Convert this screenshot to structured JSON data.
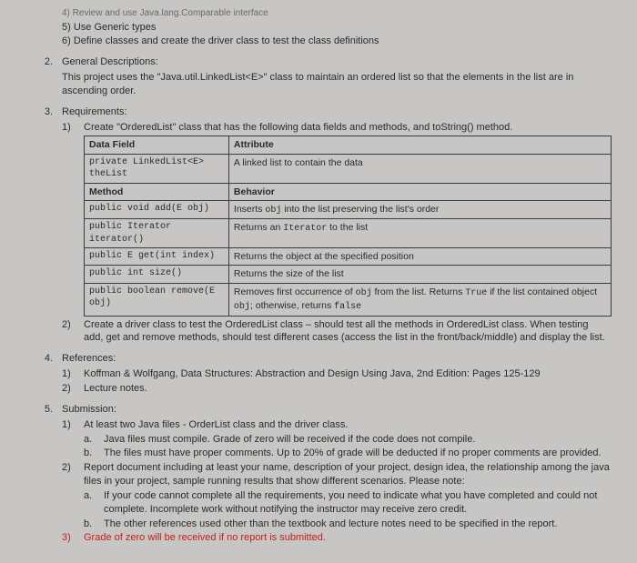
{
  "top": {
    "line4": "4) Review and use Java.lang.Comparable interface",
    "line5": "5) Use Generic types",
    "line6": "6) Define classes and create the driver class to test the class definitions"
  },
  "s2": {
    "num": "2.",
    "title": "General Descriptions:",
    "body": "This project uses the \"Java.util.LinkedList<E>\" class to maintain an ordered list so that the elements in the list are in ascending order."
  },
  "s3": {
    "num": "3.",
    "title": "Requirements:",
    "r1num": "1)",
    "r1": "Create \"OrderedList\" class that has the following data fields and methods, and toString() method.",
    "table": {
      "h1": "Data Field",
      "h2": "Attribute",
      "r1a": "private LinkedList<E> theList",
      "r1b": "A linked list to contain the data",
      "h3": "Method",
      "h4": "Behavior",
      "r2a": "public void add(E obj)",
      "r2b_pre": "Inserts ",
      "r2b_m": "obj",
      "r2b_post": " into the list preserving the list's order",
      "r3a": "public Iterator iterator()",
      "r3b_pre": "Returns an ",
      "r3b_m": "Iterator",
      "r3b_post": " to the list",
      "r4a": "public E get(int index)",
      "r4b": "Returns the object at the specified position",
      "r5a": "public int size()",
      "r5b": "Returns the size of the list",
      "r6a": "public boolean remove(E obj)",
      "r6b_1": "Removes first occurrence of ",
      "r6b_m1": "obj",
      "r6b_2": " from the list. Returns ",
      "r6b_m2": "True",
      "r6b_3": " if the list contained object ",
      "r6b_m3": "obj",
      "r6b_4": "; otherwise, returns ",
      "r6b_m4": "false"
    },
    "r2num": "2)",
    "r2": "Create a driver class to test the OrderedList class – should test all the methods in OrderedList class. When testing add, get and remove methods, should test different cases (access the list in the front/back/middle) and display the list."
  },
  "s4": {
    "num": "4.",
    "title": "References:",
    "i1n": "1)",
    "i1": "Koffman & Wolfgang, Data Structures: Abstraction and Design Using Java, 2nd Edition: Pages 125-129",
    "i2n": "2)",
    "i2": "Lecture notes."
  },
  "s5": {
    "num": "5.",
    "title": "Submission:",
    "i1n": "1)",
    "i1": "At least two Java files - OrderList class and the driver class.",
    "an": "a.",
    "a": "Java files must compile. Grade of zero will be received if the code does not compile.",
    "bn": "b.",
    "b": "The files must have proper comments. Up to 20% of grade will be deducted if no proper comments are provided.",
    "i2n": "2)",
    "i2": "Report document including at least your name, description of your project, design idea, the relationship among the java files in your project, sample running results that show different scenarios. Please note:",
    "a2n": "a.",
    "a2": "If your code cannot complete all the requirements, you need to indicate what you have completed and could not complete. Incomplete work without notifying the instructor may receive zero credit.",
    "b2n": "b.",
    "b2": "The other references used other than the textbook and lecture notes need to be specified in the report.",
    "i3n": "3)",
    "i3": "Grade of zero will be received if no report is submitted."
  }
}
